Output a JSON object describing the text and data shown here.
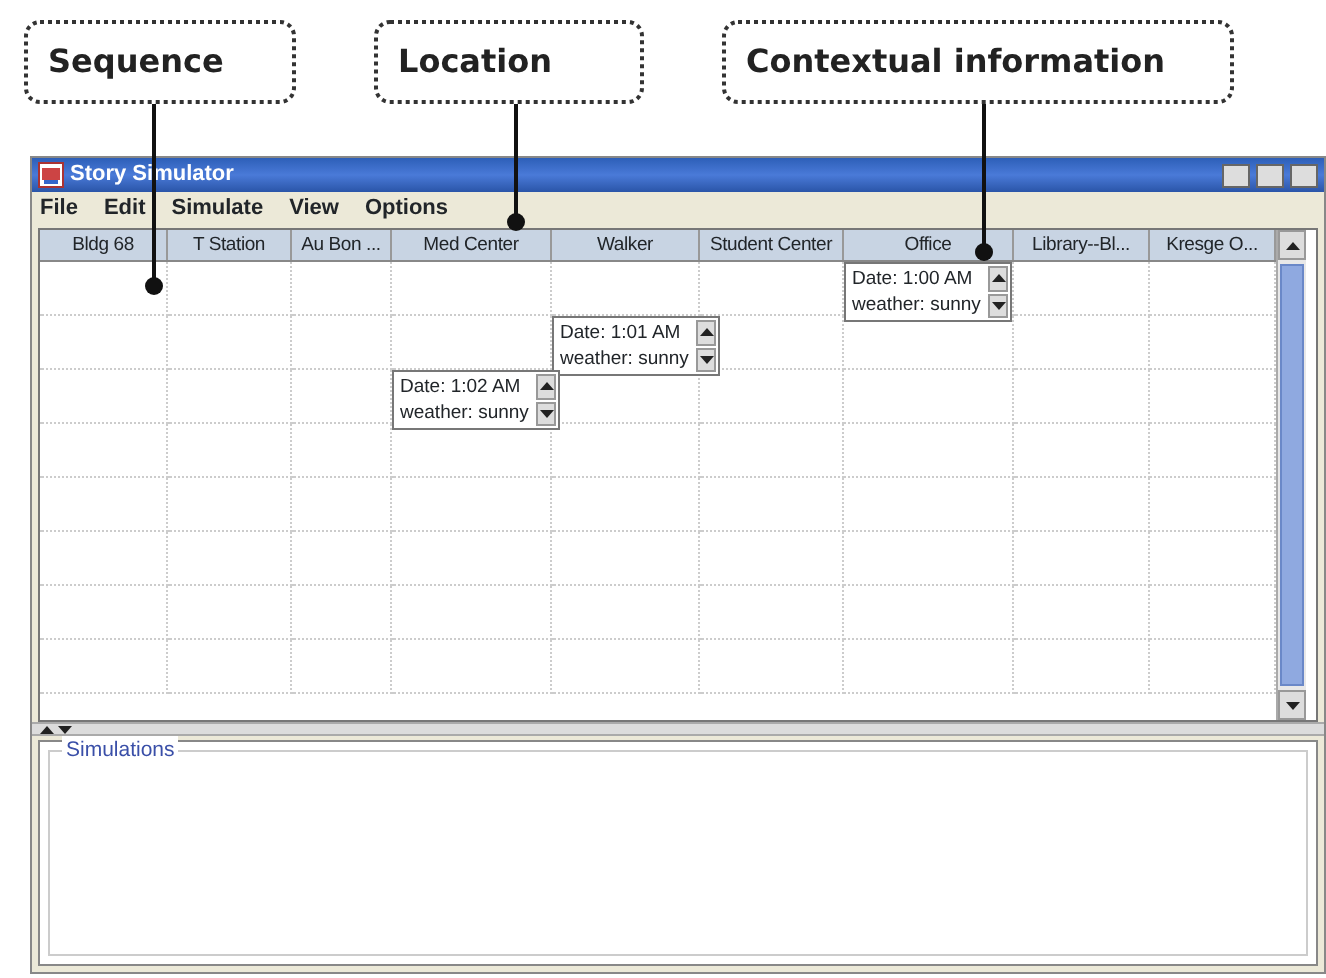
{
  "annotations": [
    {
      "label": "Sequence"
    },
    {
      "label": "Location"
    },
    {
      "label": "Contextual information"
    }
  ],
  "window": {
    "title": "Story Simulator"
  },
  "menu": [
    "File",
    "Edit",
    "Simulate",
    "View",
    "Options"
  ],
  "table": {
    "columns": [
      "Bldg 68",
      "T Station",
      "Au Bon ...",
      "Med Center",
      "Walker",
      "Student Center",
      "Office",
      "Library--Bl...",
      "Kresge O..."
    ],
    "rows": [
      [
        null,
        null,
        null,
        null,
        null,
        null,
        {
          "lines": [
            "Date: 1:00 AM",
            "weather: sunny"
          ]
        },
        null,
        null
      ],
      [
        null,
        null,
        null,
        null,
        {
          "lines": [
            "Date: 1:01 AM",
            "weather: sunny"
          ]
        },
        null,
        null,
        null,
        null
      ],
      [
        null,
        null,
        null,
        {
          "lines": [
            "Date: 1:02 AM",
            "weather: sunny"
          ]
        },
        null,
        null,
        null,
        null,
        null
      ],
      [
        null,
        null,
        null,
        null,
        null,
        null,
        null,
        null,
        null
      ],
      [
        null,
        null,
        null,
        null,
        null,
        null,
        null,
        null,
        null
      ],
      [
        null,
        null,
        null,
        null,
        null,
        null,
        null,
        null,
        null
      ],
      [
        null,
        null,
        null,
        null,
        null,
        null,
        null,
        null,
        null
      ],
      [
        null,
        null,
        null,
        null,
        null,
        null,
        null,
        null,
        null
      ]
    ]
  },
  "simulations": {
    "title": "Simulations"
  }
}
